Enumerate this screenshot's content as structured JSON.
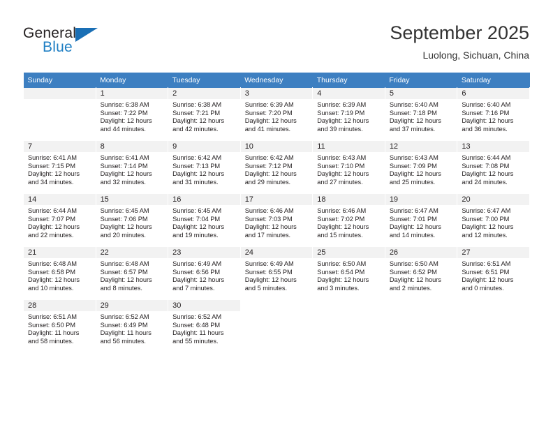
{
  "brand": {
    "name_part1": "General",
    "name_part2": "Blue",
    "accent_color": "#1a6fb5"
  },
  "header": {
    "title": "September 2025",
    "subtitle": "Luolong, Sichuan, China"
  },
  "calendar": {
    "header_color": "#3d7fc1",
    "weekdays": [
      "Sunday",
      "Monday",
      "Tuesday",
      "Wednesday",
      "Thursday",
      "Friday",
      "Saturday"
    ],
    "weeks": [
      [
        {
          "day": "",
          "sunrise": "",
          "sunset": "",
          "daylight1": "",
          "daylight2": "",
          "empty": true
        },
        {
          "day": "1",
          "sunrise": "Sunrise: 6:38 AM",
          "sunset": "Sunset: 7:22 PM",
          "daylight1": "Daylight: 12 hours",
          "daylight2": "and 44 minutes."
        },
        {
          "day": "2",
          "sunrise": "Sunrise: 6:38 AM",
          "sunset": "Sunset: 7:21 PM",
          "daylight1": "Daylight: 12 hours",
          "daylight2": "and 42 minutes."
        },
        {
          "day": "3",
          "sunrise": "Sunrise: 6:39 AM",
          "sunset": "Sunset: 7:20 PM",
          "daylight1": "Daylight: 12 hours",
          "daylight2": "and 41 minutes."
        },
        {
          "day": "4",
          "sunrise": "Sunrise: 6:39 AM",
          "sunset": "Sunset: 7:19 PM",
          "daylight1": "Daylight: 12 hours",
          "daylight2": "and 39 minutes."
        },
        {
          "day": "5",
          "sunrise": "Sunrise: 6:40 AM",
          "sunset": "Sunset: 7:18 PM",
          "daylight1": "Daylight: 12 hours",
          "daylight2": "and 37 minutes."
        },
        {
          "day": "6",
          "sunrise": "Sunrise: 6:40 AM",
          "sunset": "Sunset: 7:16 PM",
          "daylight1": "Daylight: 12 hours",
          "daylight2": "and 36 minutes."
        }
      ],
      [
        {
          "day": "7",
          "sunrise": "Sunrise: 6:41 AM",
          "sunset": "Sunset: 7:15 PM",
          "daylight1": "Daylight: 12 hours",
          "daylight2": "and 34 minutes."
        },
        {
          "day": "8",
          "sunrise": "Sunrise: 6:41 AM",
          "sunset": "Sunset: 7:14 PM",
          "daylight1": "Daylight: 12 hours",
          "daylight2": "and 32 minutes."
        },
        {
          "day": "9",
          "sunrise": "Sunrise: 6:42 AM",
          "sunset": "Sunset: 7:13 PM",
          "daylight1": "Daylight: 12 hours",
          "daylight2": "and 31 minutes."
        },
        {
          "day": "10",
          "sunrise": "Sunrise: 6:42 AM",
          "sunset": "Sunset: 7:12 PM",
          "daylight1": "Daylight: 12 hours",
          "daylight2": "and 29 minutes."
        },
        {
          "day": "11",
          "sunrise": "Sunrise: 6:43 AM",
          "sunset": "Sunset: 7:10 PM",
          "daylight1": "Daylight: 12 hours",
          "daylight2": "and 27 minutes."
        },
        {
          "day": "12",
          "sunrise": "Sunrise: 6:43 AM",
          "sunset": "Sunset: 7:09 PM",
          "daylight1": "Daylight: 12 hours",
          "daylight2": "and 25 minutes."
        },
        {
          "day": "13",
          "sunrise": "Sunrise: 6:44 AM",
          "sunset": "Sunset: 7:08 PM",
          "daylight1": "Daylight: 12 hours",
          "daylight2": "and 24 minutes."
        }
      ],
      [
        {
          "day": "14",
          "sunrise": "Sunrise: 6:44 AM",
          "sunset": "Sunset: 7:07 PM",
          "daylight1": "Daylight: 12 hours",
          "daylight2": "and 22 minutes."
        },
        {
          "day": "15",
          "sunrise": "Sunrise: 6:45 AM",
          "sunset": "Sunset: 7:06 PM",
          "daylight1": "Daylight: 12 hours",
          "daylight2": "and 20 minutes."
        },
        {
          "day": "16",
          "sunrise": "Sunrise: 6:45 AM",
          "sunset": "Sunset: 7:04 PM",
          "daylight1": "Daylight: 12 hours",
          "daylight2": "and 19 minutes."
        },
        {
          "day": "17",
          "sunrise": "Sunrise: 6:46 AM",
          "sunset": "Sunset: 7:03 PM",
          "daylight1": "Daylight: 12 hours",
          "daylight2": "and 17 minutes."
        },
        {
          "day": "18",
          "sunrise": "Sunrise: 6:46 AM",
          "sunset": "Sunset: 7:02 PM",
          "daylight1": "Daylight: 12 hours",
          "daylight2": "and 15 minutes."
        },
        {
          "day": "19",
          "sunrise": "Sunrise: 6:47 AM",
          "sunset": "Sunset: 7:01 PM",
          "daylight1": "Daylight: 12 hours",
          "daylight2": "and 14 minutes."
        },
        {
          "day": "20",
          "sunrise": "Sunrise: 6:47 AM",
          "sunset": "Sunset: 7:00 PM",
          "daylight1": "Daylight: 12 hours",
          "daylight2": "and 12 minutes."
        }
      ],
      [
        {
          "day": "21",
          "sunrise": "Sunrise: 6:48 AM",
          "sunset": "Sunset: 6:58 PM",
          "daylight1": "Daylight: 12 hours",
          "daylight2": "and 10 minutes."
        },
        {
          "day": "22",
          "sunrise": "Sunrise: 6:48 AM",
          "sunset": "Sunset: 6:57 PM",
          "daylight1": "Daylight: 12 hours",
          "daylight2": "and 8 minutes."
        },
        {
          "day": "23",
          "sunrise": "Sunrise: 6:49 AM",
          "sunset": "Sunset: 6:56 PM",
          "daylight1": "Daylight: 12 hours",
          "daylight2": "and 7 minutes."
        },
        {
          "day": "24",
          "sunrise": "Sunrise: 6:49 AM",
          "sunset": "Sunset: 6:55 PM",
          "daylight1": "Daylight: 12 hours",
          "daylight2": "and 5 minutes."
        },
        {
          "day": "25",
          "sunrise": "Sunrise: 6:50 AM",
          "sunset": "Sunset: 6:54 PM",
          "daylight1": "Daylight: 12 hours",
          "daylight2": "and 3 minutes."
        },
        {
          "day": "26",
          "sunrise": "Sunrise: 6:50 AM",
          "sunset": "Sunset: 6:52 PM",
          "daylight1": "Daylight: 12 hours",
          "daylight2": "and 2 minutes."
        },
        {
          "day": "27",
          "sunrise": "Sunrise: 6:51 AM",
          "sunset": "Sunset: 6:51 PM",
          "daylight1": "Daylight: 12 hours",
          "daylight2": "and 0 minutes."
        }
      ],
      [
        {
          "day": "28",
          "sunrise": "Sunrise: 6:51 AM",
          "sunset": "Sunset: 6:50 PM",
          "daylight1": "Daylight: 11 hours",
          "daylight2": "and 58 minutes."
        },
        {
          "day": "29",
          "sunrise": "Sunrise: 6:52 AM",
          "sunset": "Sunset: 6:49 PM",
          "daylight1": "Daylight: 11 hours",
          "daylight2": "and 56 minutes."
        },
        {
          "day": "30",
          "sunrise": "Sunrise: 6:52 AM",
          "sunset": "Sunset: 6:48 PM",
          "daylight1": "Daylight: 11 hours",
          "daylight2": "and 55 minutes."
        },
        {
          "day": "",
          "sunrise": "",
          "sunset": "",
          "daylight1": "",
          "daylight2": "",
          "blank": true
        },
        {
          "day": "",
          "sunrise": "",
          "sunset": "",
          "daylight1": "",
          "daylight2": "",
          "blank": true
        },
        {
          "day": "",
          "sunrise": "",
          "sunset": "",
          "daylight1": "",
          "daylight2": "",
          "blank": true
        },
        {
          "day": "",
          "sunrise": "",
          "sunset": "",
          "daylight1": "",
          "daylight2": "",
          "blank": true
        }
      ]
    ]
  }
}
